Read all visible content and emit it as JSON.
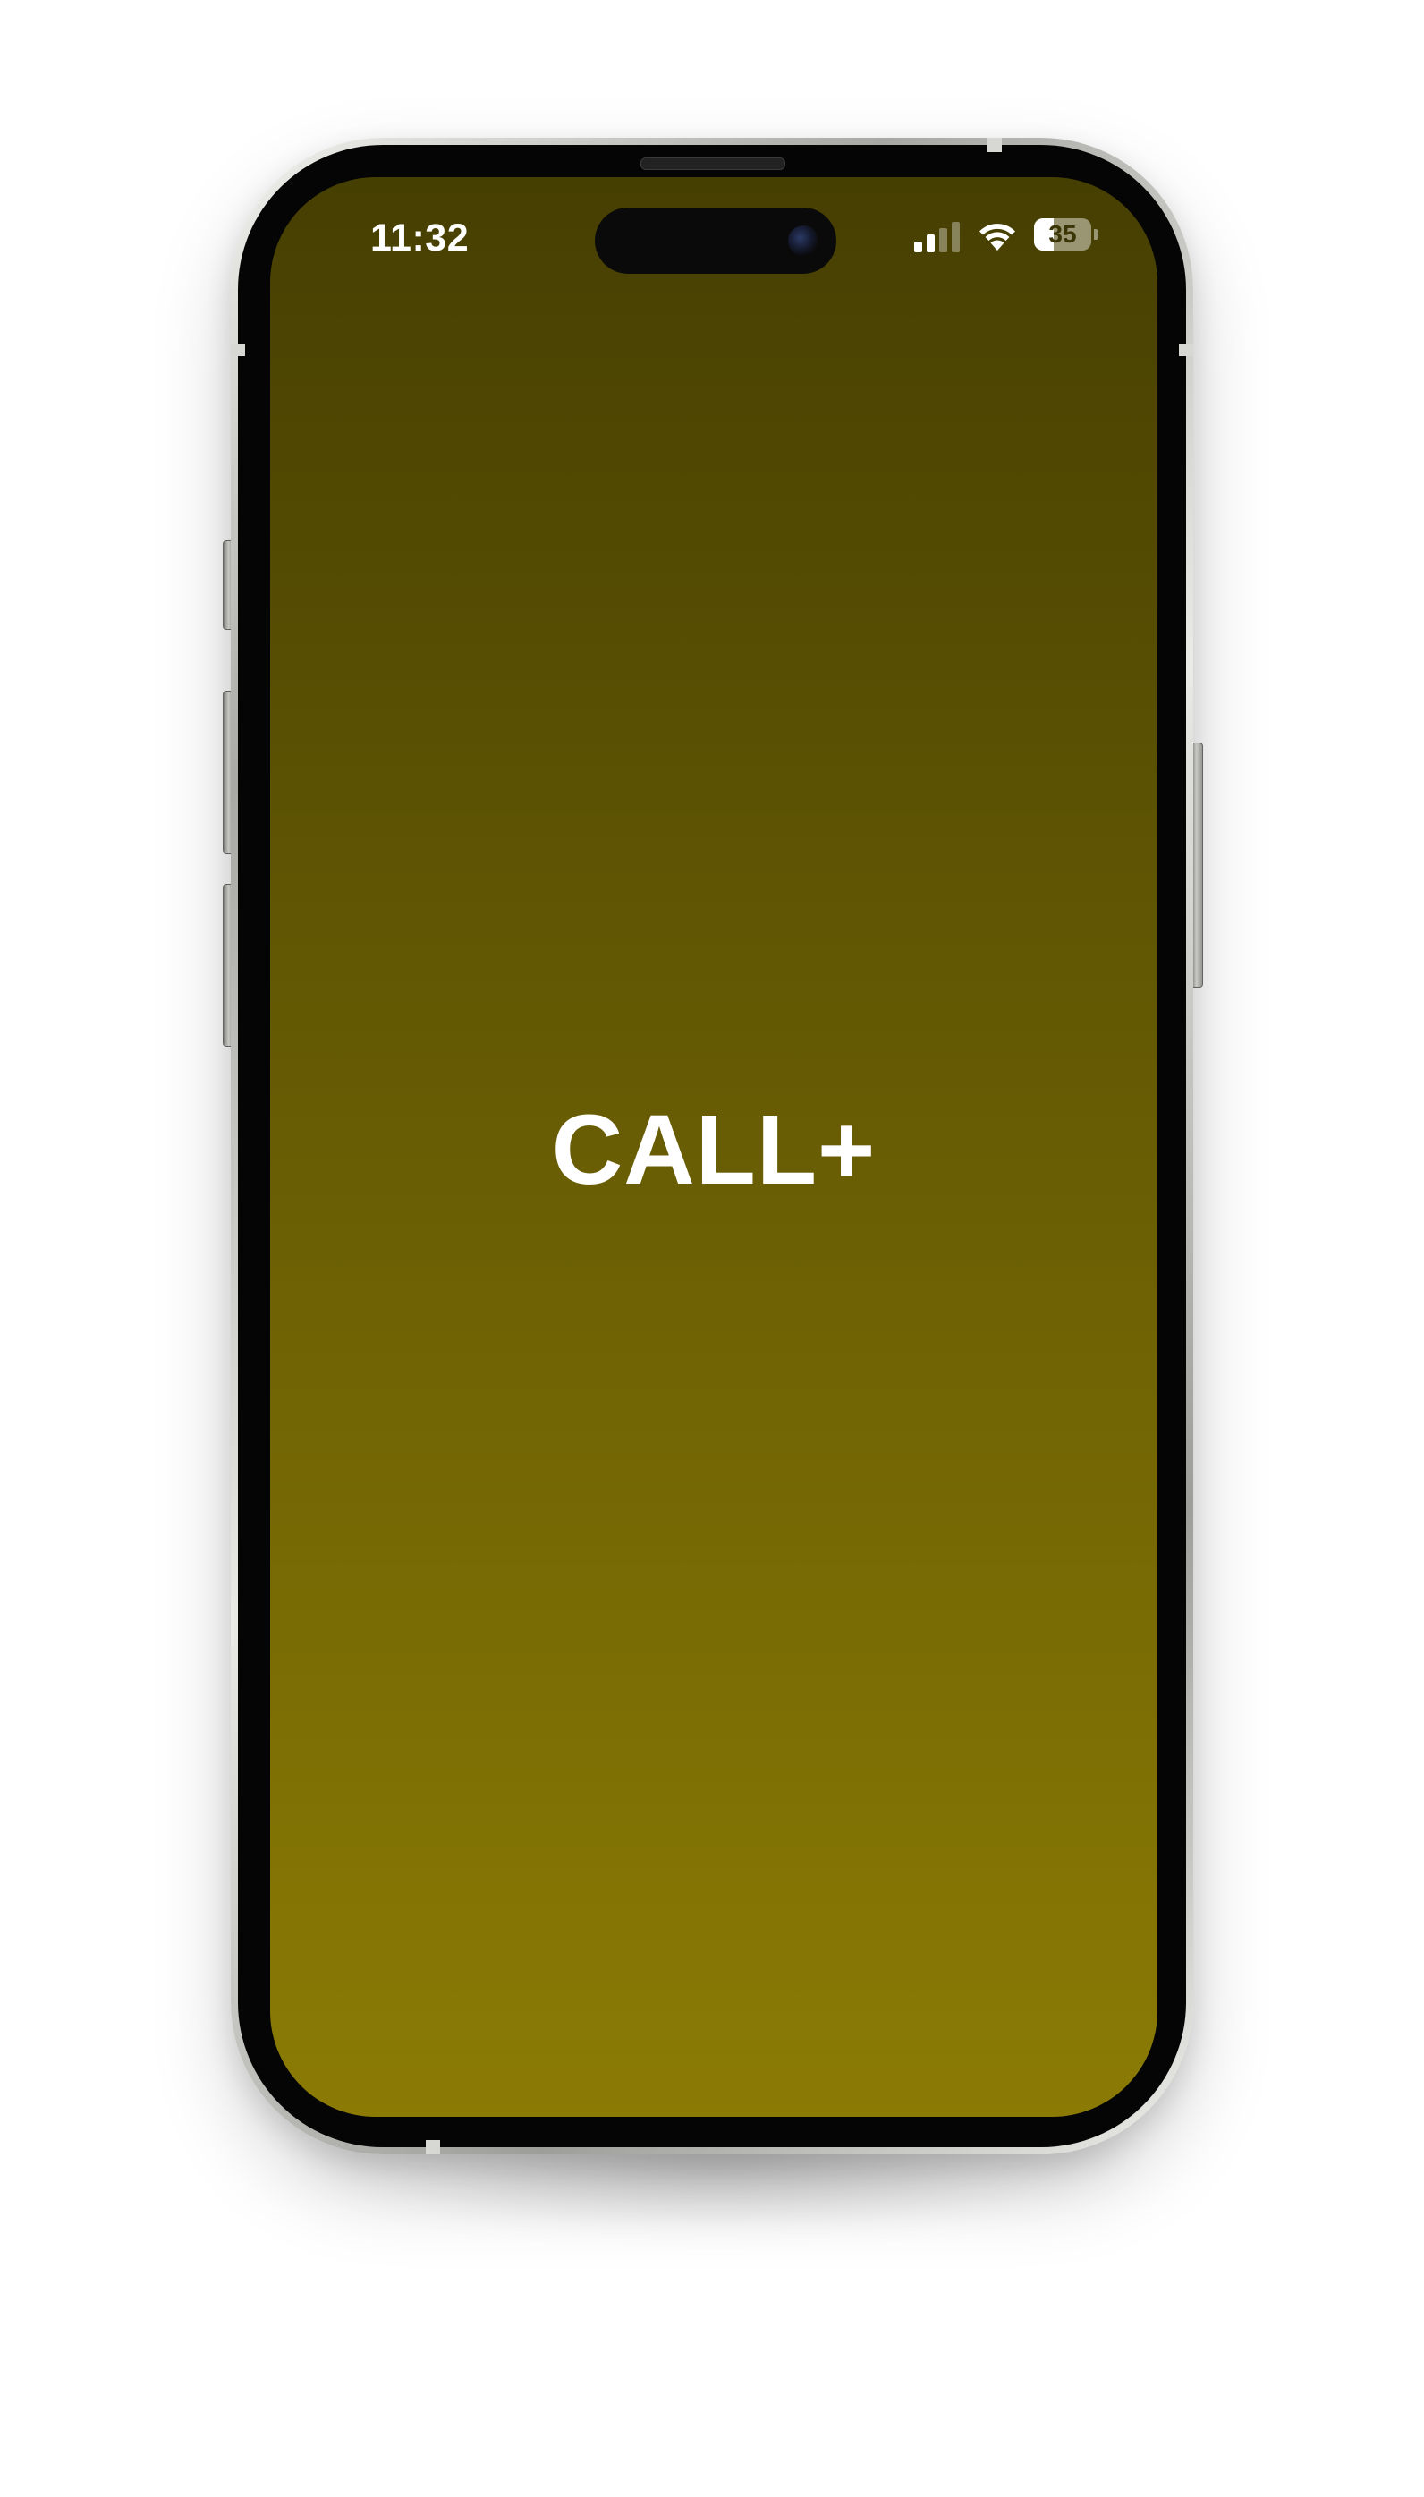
{
  "status_bar": {
    "time": "11:32",
    "battery_level": "35",
    "battery_fraction": 0.35,
    "signal_bars_active": 2,
    "signal_bars_total": 4,
    "icons": [
      "signal-bars-icon",
      "wifi-icon",
      "battery-icon"
    ]
  },
  "splash": {
    "logo_text": "CALL+"
  },
  "colors": {
    "gradient_top": "#463f02",
    "gradient_bottom": "#8b7b05",
    "logo_color": "#ffffff"
  }
}
